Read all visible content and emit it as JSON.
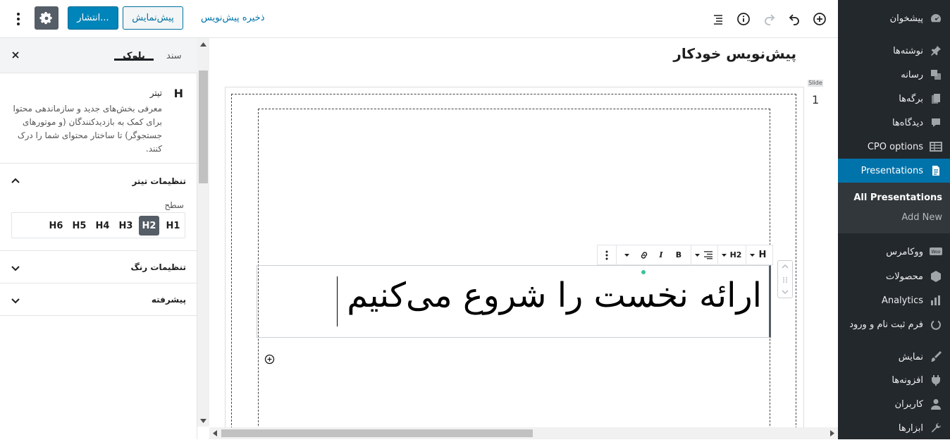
{
  "admin_menu": {
    "items": [
      {
        "label": "پیشخوان",
        "icon": "dashboard-icon"
      },
      {
        "label": "نوشته‌ها",
        "icon": "pin-icon"
      },
      {
        "label": "رسانه",
        "icon": "media-icon"
      },
      {
        "label": "برگه‌ها",
        "icon": "pages-icon"
      },
      {
        "label": "دیدگاه‌ها",
        "icon": "comments-icon"
      },
      {
        "label": "CPO options",
        "icon": "table-icon"
      },
      {
        "label": "Presentations",
        "icon": "document-icon"
      },
      {
        "label": "ووکامرس",
        "icon": "woo-icon"
      },
      {
        "label": "محصولات",
        "icon": "box-icon"
      },
      {
        "label": "Analytics",
        "icon": "bar-chart-icon"
      },
      {
        "label": "فرم ثبت نام و ورود",
        "icon": "power-icon"
      },
      {
        "label": "نمایش",
        "icon": "brush-icon"
      },
      {
        "label": "افزونه‌ها",
        "icon": "plugin-icon"
      },
      {
        "label": "کاربران",
        "icon": "user-icon"
      },
      {
        "label": "ابزارها",
        "icon": "wrench-icon"
      }
    ],
    "submenu": {
      "all": "All Presentations",
      "add_new": "Add New"
    },
    "current": "Presentations"
  },
  "topbar": {
    "publish_label": "انتشار...",
    "preview_label": "پیش‌نمایش",
    "save_draft_label": "ذخیره پیش‌نویس"
  },
  "settings": {
    "tabs": {
      "block": "بلوک",
      "document": "سند"
    },
    "block": {
      "icon_letter": "H",
      "title": "تیتر",
      "description": "معرفی بخش‌های جدید و سازماندهی محتوا برای کمک به بازدیدکنندگان (و موتورهای جستجوگر) تا ساختار محتوای شما را درک کنند."
    },
    "panels": {
      "heading_settings": "تنظیمات تیتر",
      "level_label": "سطح",
      "levels": [
        "H1",
        "H2",
        "H3",
        "H4",
        "H5",
        "H6"
      ],
      "active_level": "H2",
      "color_settings": "تنظیمات رنگ",
      "advanced": "پیشرفته"
    }
  },
  "editor": {
    "doc_title": "پیش‌نویس خودکار",
    "slide_number": "1",
    "slide_tag": "Slide",
    "heading_text": "ارائه نخست را شروع می‌کنیم",
    "block_toolbar": {
      "type_letter": "H",
      "level": "H2",
      "bold": "B",
      "italic": "I"
    }
  }
}
